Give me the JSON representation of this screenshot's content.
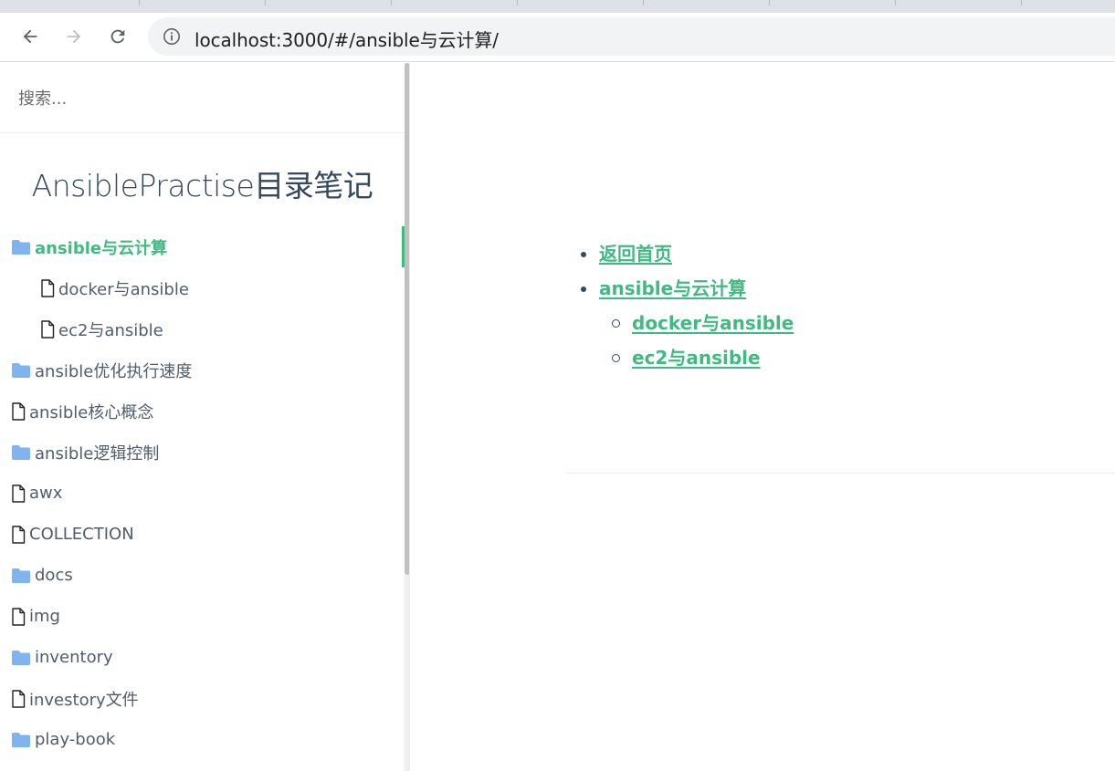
{
  "browser": {
    "url": "localhost:3000/#/ansible与云计算/",
    "back_icon": "arrow-left-icon",
    "forward_icon": "arrow-right-icon",
    "reload_icon": "reload-icon",
    "info_icon": "info-icon"
  },
  "sidebar": {
    "search_placeholder": "搜索...",
    "app_name": "AnsiblePractise目录笔记",
    "items": [
      {
        "label": "ansible与云计算",
        "icon": "folder-icon",
        "level": 0,
        "active": true
      },
      {
        "label": "docker与ansible",
        "icon": "file-icon",
        "level": 1,
        "active": false
      },
      {
        "label": "ec2与ansible",
        "icon": "file-icon",
        "level": 1,
        "active": false
      },
      {
        "label": "ansible优化执行速度",
        "icon": "folder-icon",
        "level": 0,
        "active": false
      },
      {
        "label": "ansible核心概念",
        "icon": "file-icon",
        "level": 0,
        "active": false
      },
      {
        "label": "ansible逻辑控制",
        "icon": "folder-icon",
        "level": 0,
        "active": false
      },
      {
        "label": "awx",
        "icon": "file-icon",
        "level": 0,
        "active": false
      },
      {
        "label": "COLLECTION",
        "icon": "file-icon",
        "level": 0,
        "active": false
      },
      {
        "label": "docs",
        "icon": "folder-icon",
        "level": 0,
        "active": false
      },
      {
        "label": "img",
        "icon": "file-icon",
        "level": 0,
        "active": false
      },
      {
        "label": "inventory",
        "icon": "folder-icon",
        "level": 0,
        "active": false
      },
      {
        "label": "investory文件",
        "icon": "file-icon",
        "level": 0,
        "active": false
      },
      {
        "label": "play-book",
        "icon": "folder-icon",
        "level": 0,
        "active": false
      }
    ]
  },
  "main": {
    "toc": [
      {
        "label": "返回首页",
        "level": 0
      },
      {
        "label": "ansible与云计算",
        "level": 0
      },
      {
        "label": "docker与ansible",
        "level": 1
      },
      {
        "label": "ec2与ansible",
        "level": 1
      }
    ]
  },
  "colors": {
    "accent": "#42b983",
    "text": "#34495e",
    "folder": "#7fb4f0"
  }
}
